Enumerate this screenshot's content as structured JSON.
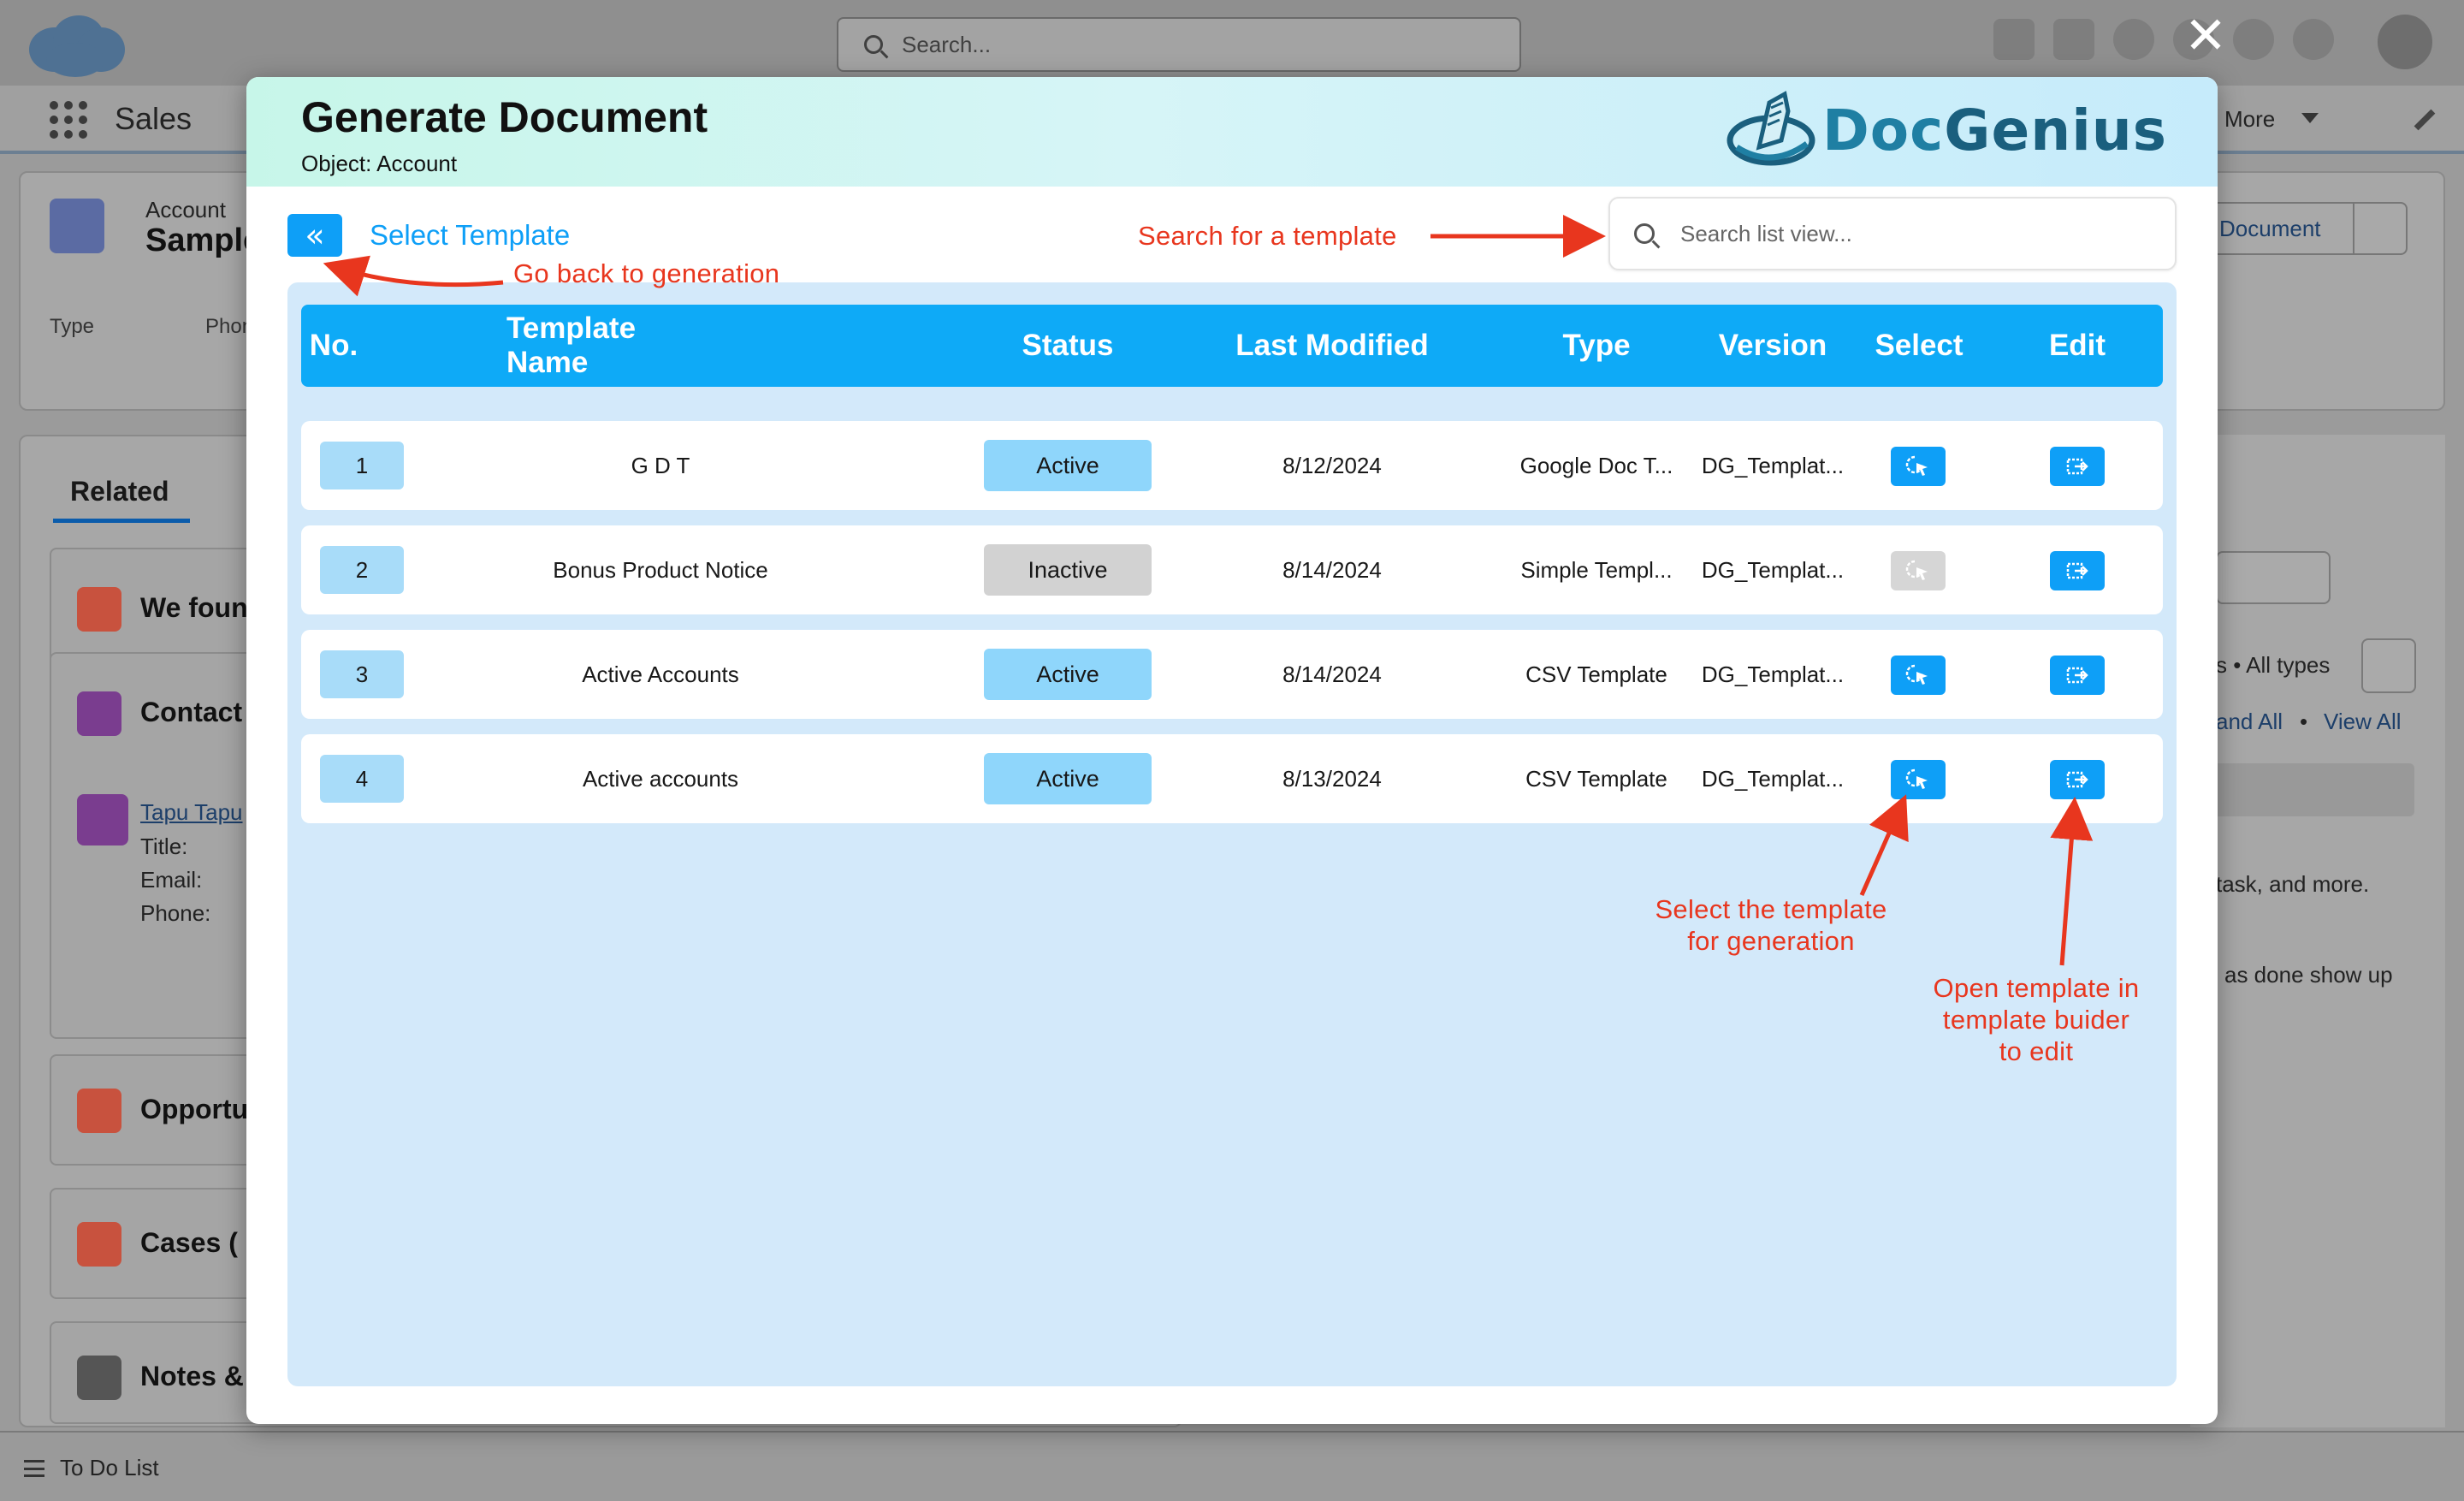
{
  "background": {
    "search_placeholder": "Search...",
    "app_name": "Sales",
    "nav_more": "More",
    "record_type_label": "Account",
    "record_name": "Sample",
    "field_type": "Type",
    "field_phone": "Phon",
    "generate_button_partial": "Document",
    "related_tab": "Related",
    "cards": [
      {
        "title": "We foun",
        "icon": "alert-icon",
        "color": "#c8523e"
      },
      {
        "title": "Contact",
        "icon": "contact-icon",
        "color": "#7a3d8f"
      },
      {
        "title": "Opportu",
        "icon": "opportunity-icon",
        "color": "#c8523e"
      },
      {
        "title": "Cases (",
        "icon": "case-icon",
        "color": "#c8523e"
      },
      {
        "title": "Notes &",
        "icon": "notes-icon",
        "color": "#555555"
      }
    ],
    "contact": {
      "name": "Tapu Tapu",
      "title_label": "Title:",
      "email_label": "Email:",
      "phone_label": "Phone:"
    },
    "right_panel": {
      "filter_text": "s • All types",
      "expand_all": "and All",
      "separator": "•",
      "view_all": "View All",
      "task_text": "task, and more.",
      "done_text": "as done show up"
    },
    "footer_label": "To Do List"
  },
  "modal": {
    "title": "Generate Document",
    "subtitle": "Object: Account",
    "brand_doc": "Doc",
    "brand_genius": "Genius",
    "close_symbol": "✕",
    "back_symbol": "«",
    "section_title": "Select Template",
    "search_placeholder": "Search list view...",
    "columns": [
      "No.",
      "Template Name",
      "Status",
      "Last Modified",
      "Type",
      "Version",
      "Select",
      "Edit"
    ],
    "rows": [
      {
        "no": "1",
        "name": "G D T",
        "status": "Active",
        "modified": "8/12/2024",
        "type": "Google Doc T...",
        "version": "DG_Templat...",
        "selectable": true
      },
      {
        "no": "2",
        "name": "Bonus Product Notice",
        "status": "Inactive",
        "modified": "8/14/2024",
        "type": "Simple Templ...",
        "version": "DG_Templat...",
        "selectable": false
      },
      {
        "no": "3",
        "name": "Active Accounts",
        "status": "Active",
        "modified": "8/14/2024",
        "type": "CSV Template",
        "version": "DG_Templat...",
        "selectable": true
      },
      {
        "no": "4",
        "name": "Active accounts",
        "status": "Active",
        "modified": "8/13/2024",
        "type": "CSV Template",
        "version": "DG_Templat...",
        "selectable": true
      }
    ]
  },
  "annotations": {
    "back": "Go back to generation",
    "search": "Search for a template",
    "select_line1": "Select the template",
    "select_line2": "for generation",
    "edit_line1": "Open template in",
    "edit_line2": "template buider",
    "edit_line3": "to edit",
    "color": "#e8361e"
  },
  "colors": {
    "accent": "#0e9ff7",
    "header_blue": "#0eaaf7",
    "table_bg": "#d3e9fa",
    "active_pill": "#8fd6fb",
    "inactive_pill": "#d2d2d2"
  }
}
